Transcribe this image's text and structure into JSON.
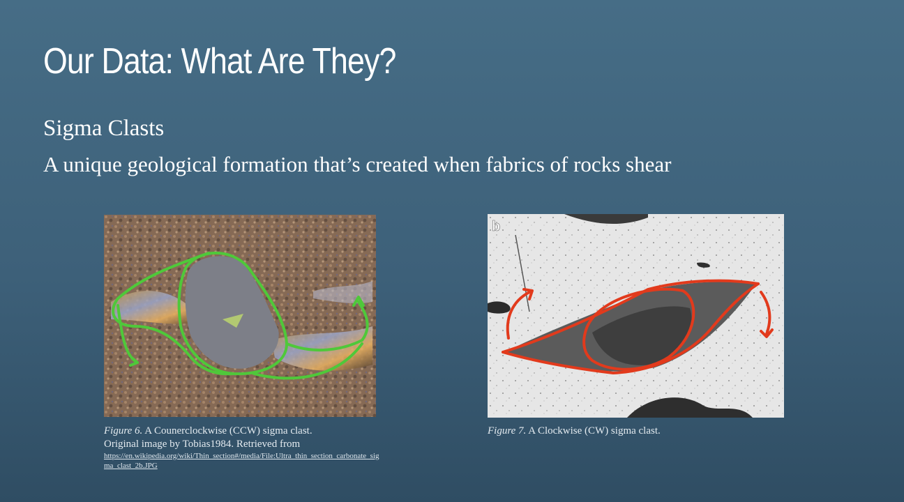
{
  "slide": {
    "title": "Our Data: What Are They?",
    "subtitle": "Sigma Clasts",
    "description": "A unique geological formation that’s created when fabrics of rocks shear"
  },
  "figure6": {
    "label": "Figure 6.",
    "caption_line1": " A Counerclockwise (CCW) sigma clast.",
    "caption_prefix": "Original image by ",
    "author": "Tobias1984",
    "caption_suffix": ". Retrieved from",
    "link": "https://en.wikipedia.org/wiki/Thin_section#/media/File:Ultra_thin_section_carbonate_sigma_clast_2b.JPG",
    "outline_color": "#4fc83a"
  },
  "figure7": {
    "label": "Figure 7.",
    "caption": " A Clockwise (CW) sigma clast.",
    "panel_letter": "b",
    "outline_color": "#e23a1c"
  }
}
